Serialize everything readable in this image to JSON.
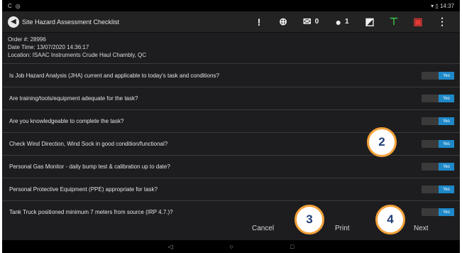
{
  "statusbar": {
    "left_icons": [
      "C",
      "◎"
    ],
    "right_text": "▾ ▯ 14:37"
  },
  "header": {
    "title": "Site Hazard Assessment Checklist",
    "icons": [
      {
        "name": "alert-icon",
        "glyph": "!"
      },
      {
        "name": "add-location-icon",
        "glyph": "⊕"
      },
      {
        "name": "mail-icon",
        "glyph": "✉",
        "count": "0"
      },
      {
        "name": "user-icon",
        "glyph": "●",
        "count": "1"
      },
      {
        "name": "edit-icon",
        "glyph": "◩"
      },
      {
        "name": "network-icon",
        "glyph": "⊤"
      },
      {
        "name": "truck-icon",
        "glyph": "▣"
      },
      {
        "name": "more-icon",
        "glyph": "⋮"
      }
    ]
  },
  "order": {
    "order_line": "Order #:   28996",
    "date_line": "Date Time: 13/07/2020 14:36:17",
    "location_line": "Location:   ISAAC Instruments Crude Haul Chambly, QC"
  },
  "questions": [
    {
      "text": "Is Job Hazard Analysis (JHA) current and applicable to today's task and conditions?",
      "answer": "Yes"
    },
    {
      "text": "Are training/tools/equipment adequate for the task?",
      "answer": "Yes"
    },
    {
      "text": "Are you knowledgeable to complete the task?",
      "answer": "Yes"
    },
    {
      "text": "Check Wind Direction, Wind Sock in good condition/functional?",
      "answer": "Yes"
    },
    {
      "text": "Personal Gas Monitor - daily bump test & calibration up to date?",
      "answer": "Yes"
    },
    {
      "text": "Personal Protective Equipment (PPE) appropriate for task?",
      "answer": "Yes"
    },
    {
      "text": "Tank Truck positioned minimum 7 meters from source (IRP 4.7.)?",
      "answer": "Yes"
    }
  ],
  "actions": {
    "cancel": "Cancel",
    "print": "Print",
    "next": "Next"
  },
  "nav": {
    "back": "◁",
    "home": "○",
    "recents": "□"
  },
  "callouts": {
    "two": "2",
    "three": "3",
    "four": "4"
  },
  "colors": {
    "toggle_on": "#1e88c9",
    "callout_border": "#f2a23a",
    "callout_text": "#1f3f7a"
  }
}
